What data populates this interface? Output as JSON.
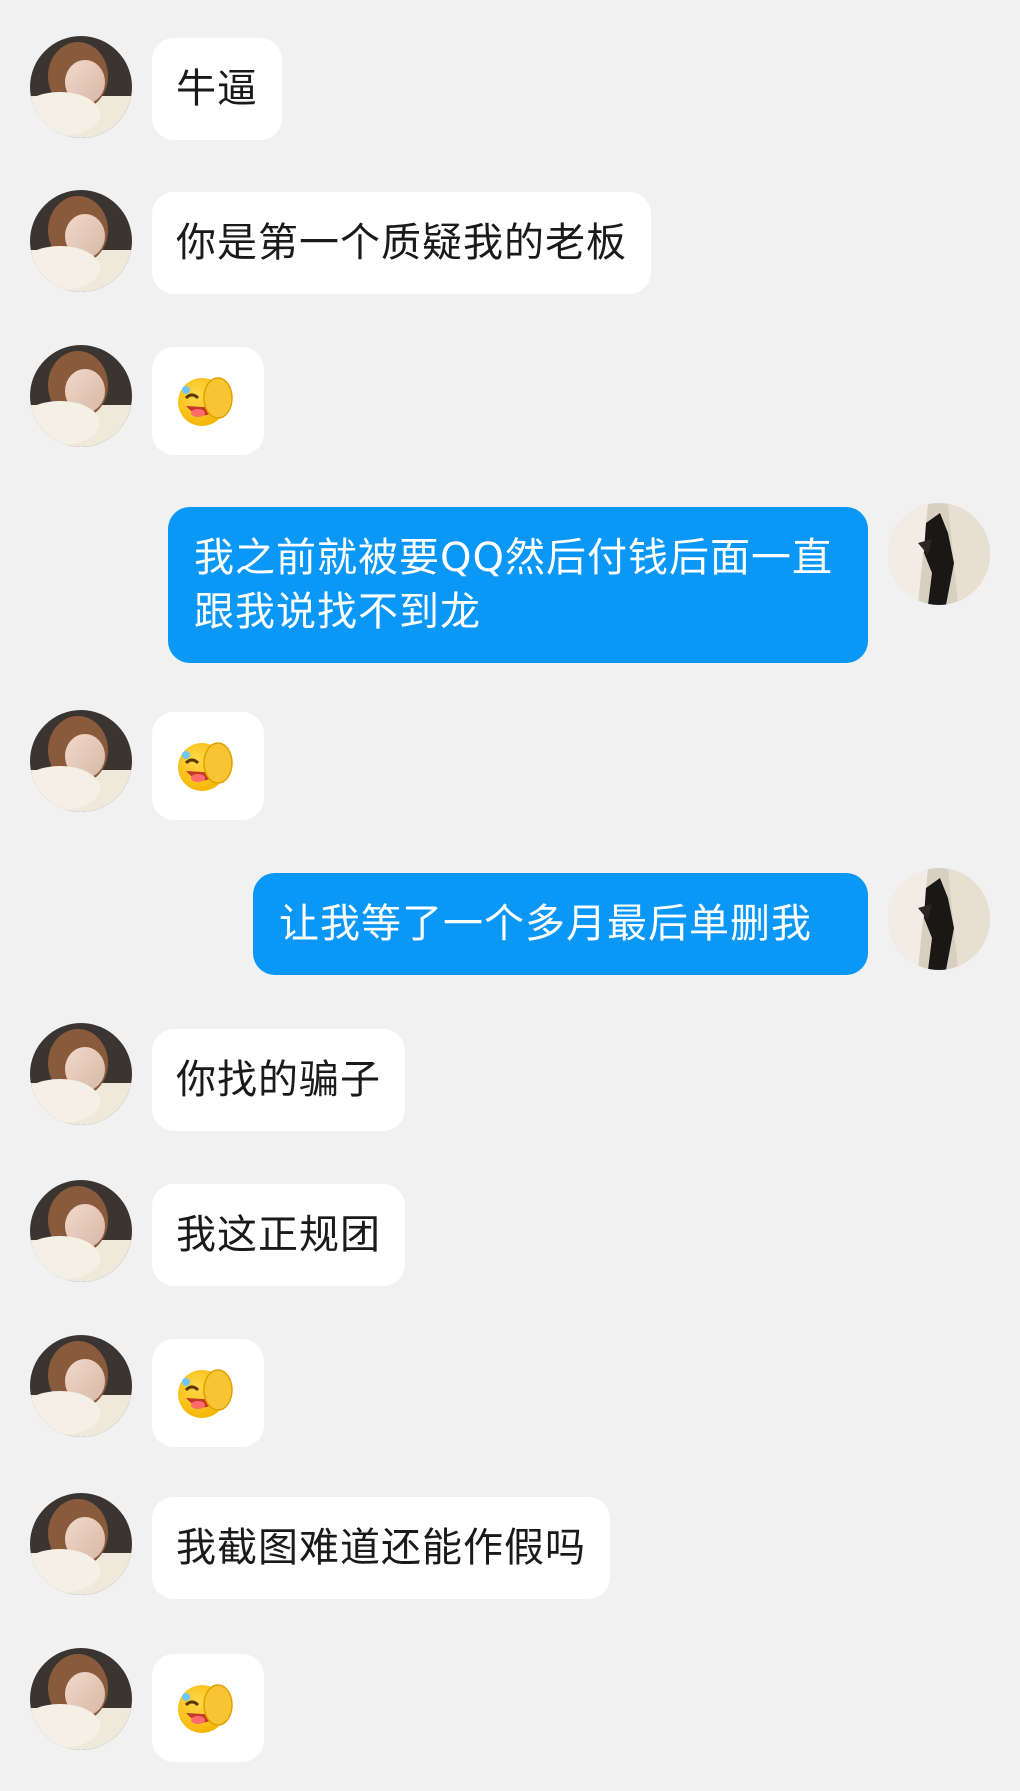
{
  "chat": {
    "messages": [
      {
        "side": "left",
        "kind": "text",
        "text": "牛逼"
      },
      {
        "side": "left",
        "kind": "text",
        "text": "你是第一个质疑我的老板"
      },
      {
        "side": "left",
        "kind": "emoji",
        "icon": "facepalm-laugh-emoji"
      },
      {
        "side": "right",
        "kind": "text",
        "text": "我之前就被要QQ然后付钱后面一直跟我说找不到龙"
      },
      {
        "side": "left",
        "kind": "emoji",
        "icon": "facepalm-laugh-emoji"
      },
      {
        "side": "right",
        "kind": "text",
        "text": "让我等了一个多月最后单删我"
      },
      {
        "side": "left",
        "kind": "text",
        "text": "你找的骗子"
      },
      {
        "side": "left",
        "kind": "text",
        "text": "我这正规团"
      },
      {
        "side": "left",
        "kind": "emoji",
        "icon": "facepalm-laugh-emoji"
      },
      {
        "side": "left",
        "kind": "text",
        "text": "我截图难道还能作假吗"
      },
      {
        "side": "left",
        "kind": "emoji",
        "icon": "facepalm-laugh-emoji"
      }
    ]
  },
  "colors": {
    "background": "#f1f1f1",
    "bubble_left": "#ffffff",
    "bubble_right": "#0a97f5",
    "text_left": "#1a1a1a",
    "text_right": "#ffffff"
  }
}
